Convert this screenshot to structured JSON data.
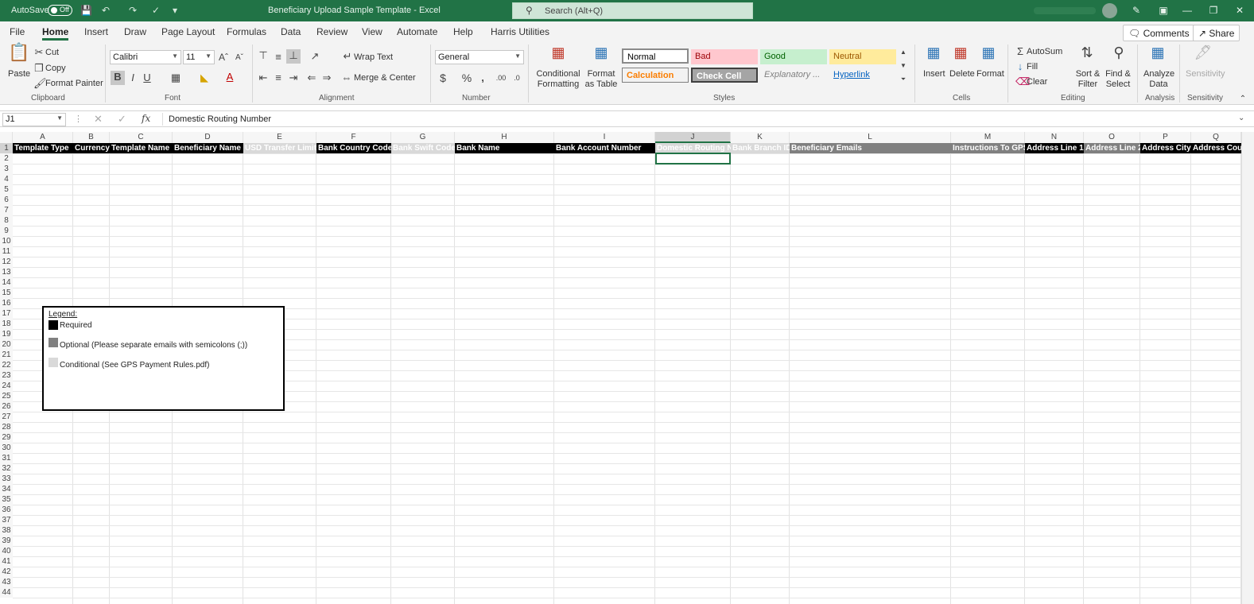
{
  "titlebar": {
    "autosave_label": "AutoSave",
    "autosave_state": "Off",
    "doc_title": "Beneficiary Upload Sample Template  -  Excel",
    "search_placeholder": "Search (Alt+Q)"
  },
  "menu": {
    "tabs": [
      "File",
      "Home",
      "Insert",
      "Draw",
      "Page Layout",
      "Formulas",
      "Data",
      "Review",
      "View",
      "Automate",
      "Help",
      "Harris Utilities"
    ],
    "active": "Home",
    "comments_label": "Comments",
    "share_label": "Share"
  },
  "ribbon": {
    "clipboard": {
      "paste": "Paste",
      "cut": "Cut",
      "copy": "Copy",
      "format_painter": "Format Painter",
      "label": "Clipboard"
    },
    "font": {
      "name": "Calibri",
      "size": "11",
      "label": "Font",
      "bold": "B",
      "italic": "I",
      "underline": "U"
    },
    "alignment": {
      "wrap_text": "Wrap Text",
      "merge_center": "Merge & Center",
      "label": "Alignment"
    },
    "number": {
      "format": "General",
      "label": "Number"
    },
    "styles": {
      "conditional_formatting": "Conditional Formatting",
      "format_as_table": "Format as Table",
      "cells": [
        "Normal",
        "Bad",
        "Good",
        "Neutral",
        "Calculation",
        "Check Cell",
        "Explanatory ...",
        "Hyperlink"
      ],
      "label": "Styles"
    },
    "cells": {
      "insert": "Insert",
      "delete": "Delete",
      "format": "Format",
      "label": "Cells"
    },
    "editing": {
      "autosum": "AutoSum",
      "fill": "Fill",
      "clear": "Clear",
      "sort_filter": "Sort & Filter",
      "find_select": "Find & Select",
      "label": "Editing"
    },
    "analysis": {
      "analyze_data": "Analyze Data",
      "label": "Analysis"
    },
    "sensitivity": {
      "button": "Sensitivity",
      "label": "Sensitivity"
    }
  },
  "formula_bar": {
    "name_box": "J1",
    "content": "Domestic Routing Number"
  },
  "sheet": {
    "columns": [
      "A",
      "B",
      "C",
      "D",
      "E",
      "F",
      "G",
      "H",
      "I",
      "J",
      "K",
      "L",
      "M",
      "N",
      "O",
      "P",
      "Q"
    ],
    "header_cells": [
      {
        "text": "Template Type",
        "type": "required"
      },
      {
        "text": "Currency",
        "type": "required"
      },
      {
        "text": "Template Name",
        "type": "required"
      },
      {
        "text": "Beneficiary Name",
        "type": "required"
      },
      {
        "text": "USD Transfer Limit",
        "type": "conditional"
      },
      {
        "text": "Bank Country Code",
        "type": "required"
      },
      {
        "text": "Bank Swift Code",
        "type": "conditional"
      },
      {
        "text": "Bank Name",
        "type": "required"
      },
      {
        "text": "Bank Account Number",
        "type": "required"
      },
      {
        "text": "Domestic Routing Number",
        "type": "conditional"
      },
      {
        "text": "Bank Branch ID",
        "type": "conditional"
      },
      {
        "text": "Beneficiary Emails",
        "type": "optional"
      },
      {
        "text": "Instructions To GPS",
        "type": "optional"
      },
      {
        "text": "Address Line 1",
        "type": "required"
      },
      {
        "text": "Address Line 2",
        "type": "optional"
      },
      {
        "text": "Address City",
        "type": "required"
      },
      {
        "text": "Address Country",
        "type": "required"
      }
    ],
    "row_numbers": [
      "1",
      "2",
      "3",
      "4",
      "5",
      "6",
      "7",
      "8",
      "9",
      "10",
      "11",
      "12",
      "13",
      "14",
      "15",
      "16",
      "17",
      "18",
      "19",
      "20",
      "21",
      "22",
      "23",
      "24",
      "25",
      "26",
      "27",
      "28",
      "29",
      "30",
      "31",
      "32",
      "33",
      "34",
      "35",
      "36",
      "37",
      "38",
      "39",
      "40",
      "41",
      "42",
      "43",
      "44"
    ]
  },
  "legend": {
    "title": "Legend:",
    "items": [
      {
        "text": "Required",
        "color": "#000000"
      },
      {
        "text": "Optional (Please separate emails with semicolons (;))",
        "color": "#808080"
      },
      {
        "text": "Conditional (See GPS Payment Rules.pdf)",
        "color": "#d9d9d9"
      }
    ]
  },
  "colors": {
    "accent": "#217346",
    "required": "#000000",
    "optional": "#808080",
    "conditional": "#d9d9d9"
  }
}
